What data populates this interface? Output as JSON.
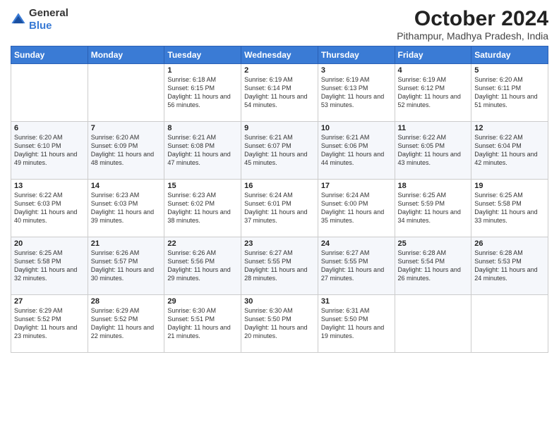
{
  "logo": {
    "general": "General",
    "blue": "Blue"
  },
  "header": {
    "month": "October 2024",
    "location": "Pithampur, Madhya Pradesh, India"
  },
  "weekdays": [
    "Sunday",
    "Monday",
    "Tuesday",
    "Wednesday",
    "Thursday",
    "Friday",
    "Saturday"
  ],
  "weeks": [
    [
      {
        "day": "",
        "sunrise": "",
        "sunset": "",
        "daylight": ""
      },
      {
        "day": "",
        "sunrise": "",
        "sunset": "",
        "daylight": ""
      },
      {
        "day": "1",
        "sunrise": "Sunrise: 6:18 AM",
        "sunset": "Sunset: 6:15 PM",
        "daylight": "Daylight: 11 hours and 56 minutes."
      },
      {
        "day": "2",
        "sunrise": "Sunrise: 6:19 AM",
        "sunset": "Sunset: 6:14 PM",
        "daylight": "Daylight: 11 hours and 54 minutes."
      },
      {
        "day": "3",
        "sunrise": "Sunrise: 6:19 AM",
        "sunset": "Sunset: 6:13 PM",
        "daylight": "Daylight: 11 hours and 53 minutes."
      },
      {
        "day": "4",
        "sunrise": "Sunrise: 6:19 AM",
        "sunset": "Sunset: 6:12 PM",
        "daylight": "Daylight: 11 hours and 52 minutes."
      },
      {
        "day": "5",
        "sunrise": "Sunrise: 6:20 AM",
        "sunset": "Sunset: 6:11 PM",
        "daylight": "Daylight: 11 hours and 51 minutes."
      }
    ],
    [
      {
        "day": "6",
        "sunrise": "Sunrise: 6:20 AM",
        "sunset": "Sunset: 6:10 PM",
        "daylight": "Daylight: 11 hours and 49 minutes."
      },
      {
        "day": "7",
        "sunrise": "Sunrise: 6:20 AM",
        "sunset": "Sunset: 6:09 PM",
        "daylight": "Daylight: 11 hours and 48 minutes."
      },
      {
        "day": "8",
        "sunrise": "Sunrise: 6:21 AM",
        "sunset": "Sunset: 6:08 PM",
        "daylight": "Daylight: 11 hours and 47 minutes."
      },
      {
        "day": "9",
        "sunrise": "Sunrise: 6:21 AM",
        "sunset": "Sunset: 6:07 PM",
        "daylight": "Daylight: 11 hours and 45 minutes."
      },
      {
        "day": "10",
        "sunrise": "Sunrise: 6:21 AM",
        "sunset": "Sunset: 6:06 PM",
        "daylight": "Daylight: 11 hours and 44 minutes."
      },
      {
        "day": "11",
        "sunrise": "Sunrise: 6:22 AM",
        "sunset": "Sunset: 6:05 PM",
        "daylight": "Daylight: 11 hours and 43 minutes."
      },
      {
        "day": "12",
        "sunrise": "Sunrise: 6:22 AM",
        "sunset": "Sunset: 6:04 PM",
        "daylight": "Daylight: 11 hours and 42 minutes."
      }
    ],
    [
      {
        "day": "13",
        "sunrise": "Sunrise: 6:22 AM",
        "sunset": "Sunset: 6:03 PM",
        "daylight": "Daylight: 11 hours and 40 minutes."
      },
      {
        "day": "14",
        "sunrise": "Sunrise: 6:23 AM",
        "sunset": "Sunset: 6:03 PM",
        "daylight": "Daylight: 11 hours and 39 minutes."
      },
      {
        "day": "15",
        "sunrise": "Sunrise: 6:23 AM",
        "sunset": "Sunset: 6:02 PM",
        "daylight": "Daylight: 11 hours and 38 minutes."
      },
      {
        "day": "16",
        "sunrise": "Sunrise: 6:24 AM",
        "sunset": "Sunset: 6:01 PM",
        "daylight": "Daylight: 11 hours and 37 minutes."
      },
      {
        "day": "17",
        "sunrise": "Sunrise: 6:24 AM",
        "sunset": "Sunset: 6:00 PM",
        "daylight": "Daylight: 11 hours and 35 minutes."
      },
      {
        "day": "18",
        "sunrise": "Sunrise: 6:25 AM",
        "sunset": "Sunset: 5:59 PM",
        "daylight": "Daylight: 11 hours and 34 minutes."
      },
      {
        "day": "19",
        "sunrise": "Sunrise: 6:25 AM",
        "sunset": "Sunset: 5:58 PM",
        "daylight": "Daylight: 11 hours and 33 minutes."
      }
    ],
    [
      {
        "day": "20",
        "sunrise": "Sunrise: 6:25 AM",
        "sunset": "Sunset: 5:58 PM",
        "daylight": "Daylight: 11 hours and 32 minutes."
      },
      {
        "day": "21",
        "sunrise": "Sunrise: 6:26 AM",
        "sunset": "Sunset: 5:57 PM",
        "daylight": "Daylight: 11 hours and 30 minutes."
      },
      {
        "day": "22",
        "sunrise": "Sunrise: 6:26 AM",
        "sunset": "Sunset: 5:56 PM",
        "daylight": "Daylight: 11 hours and 29 minutes."
      },
      {
        "day": "23",
        "sunrise": "Sunrise: 6:27 AM",
        "sunset": "Sunset: 5:55 PM",
        "daylight": "Daylight: 11 hours and 28 minutes."
      },
      {
        "day": "24",
        "sunrise": "Sunrise: 6:27 AM",
        "sunset": "Sunset: 5:55 PM",
        "daylight": "Daylight: 11 hours and 27 minutes."
      },
      {
        "day": "25",
        "sunrise": "Sunrise: 6:28 AM",
        "sunset": "Sunset: 5:54 PM",
        "daylight": "Daylight: 11 hours and 26 minutes."
      },
      {
        "day": "26",
        "sunrise": "Sunrise: 6:28 AM",
        "sunset": "Sunset: 5:53 PM",
        "daylight": "Daylight: 11 hours and 24 minutes."
      }
    ],
    [
      {
        "day": "27",
        "sunrise": "Sunrise: 6:29 AM",
        "sunset": "Sunset: 5:52 PM",
        "daylight": "Daylight: 11 hours and 23 minutes."
      },
      {
        "day": "28",
        "sunrise": "Sunrise: 6:29 AM",
        "sunset": "Sunset: 5:52 PM",
        "daylight": "Daylight: 11 hours and 22 minutes."
      },
      {
        "day": "29",
        "sunrise": "Sunrise: 6:30 AM",
        "sunset": "Sunset: 5:51 PM",
        "daylight": "Daylight: 11 hours and 21 minutes."
      },
      {
        "day": "30",
        "sunrise": "Sunrise: 6:30 AM",
        "sunset": "Sunset: 5:50 PM",
        "daylight": "Daylight: 11 hours and 20 minutes."
      },
      {
        "day": "31",
        "sunrise": "Sunrise: 6:31 AM",
        "sunset": "Sunset: 5:50 PM",
        "daylight": "Daylight: 11 hours and 19 minutes."
      },
      {
        "day": "",
        "sunrise": "",
        "sunset": "",
        "daylight": ""
      },
      {
        "day": "",
        "sunrise": "",
        "sunset": "",
        "daylight": ""
      }
    ]
  ]
}
